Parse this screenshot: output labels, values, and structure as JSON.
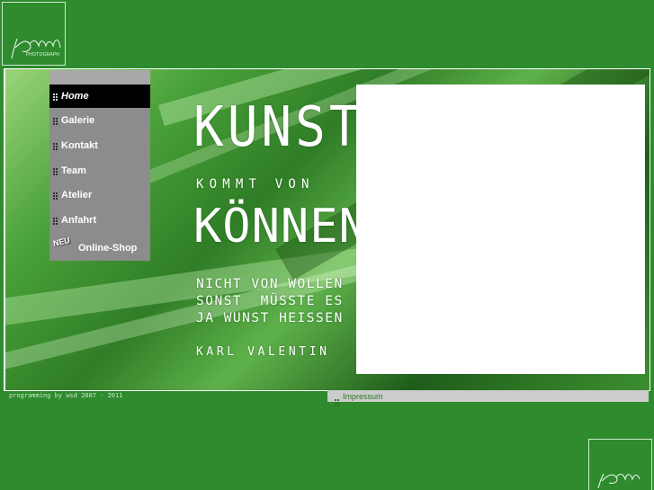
{
  "logo": {
    "signature": "H. Pongratz",
    "caption": "PHOTOGRAPH"
  },
  "nav": {
    "items": [
      {
        "label": "Home",
        "active": true
      },
      {
        "label": "Galerie",
        "active": false
      },
      {
        "label": "Kontakt",
        "active": false
      },
      {
        "label": "Team",
        "active": false
      },
      {
        "label": "Atelier",
        "active": false
      },
      {
        "label": "Anfahrt",
        "active": false
      }
    ],
    "shop_badge": "NEU",
    "shop_label": "Online-Shop"
  },
  "quote": {
    "line1": "KUNST",
    "line2": "KOMMT VON",
    "line3": "KÖNNEN",
    "line4": "NICHT VON WOLLEN",
    "line5": "SONST  MÜSSTE ES",
    "line6": "JA WUNST HEISSEN",
    "author": "KARL VALENTIN"
  },
  "footer": {
    "credit": "programming by wsd 2007 - 2011",
    "impressum": "Impressum"
  },
  "colors": {
    "page_background": "#2e8b2e",
    "nav_background": "#8c8c8c",
    "nav_active": "#000000",
    "impressum_bar": "#cccccc"
  }
}
